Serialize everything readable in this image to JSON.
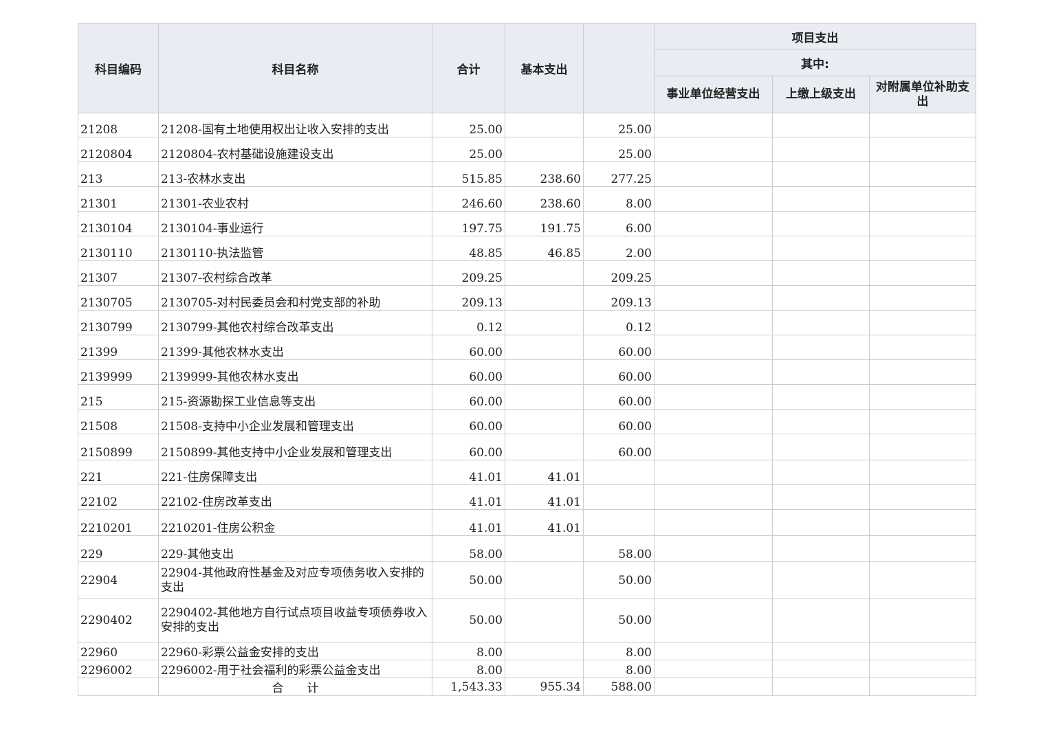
{
  "headers": {
    "code": "科目编码",
    "name": "科目名称",
    "total": "合计",
    "basic": "基本支出",
    "project": "",
    "project_group": "项目支出",
    "of_which": "其中:",
    "business": "事业单位经营支出",
    "upper": "上缴上级支出",
    "subsidy": "对附属单位补助支出"
  },
  "rows": [
    {
      "code": "21208",
      "name": "21208-国有土地使用权出让收入安排的支出",
      "total": "25.00",
      "basic": "",
      "project": "25.00"
    },
    {
      "code": "2120804",
      "name": "2120804-农村基础设施建设支出",
      "total": "25.00",
      "basic": "",
      "project": "25.00"
    },
    {
      "code": "213",
      "name": "213-农林水支出",
      "total": "515.85",
      "basic": "238.60",
      "project": "277.25"
    },
    {
      "code": "21301",
      "name": "21301-农业农村",
      "total": "246.60",
      "basic": "238.60",
      "project": "8.00"
    },
    {
      "code": "2130104",
      "name": "2130104-事业运行",
      "total": "197.75",
      "basic": "191.75",
      "project": "6.00"
    },
    {
      "code": "2130110",
      "name": "2130110-执法监管",
      "total": "48.85",
      "basic": "46.85",
      "project": "2.00"
    },
    {
      "code": "21307",
      "name": "21307-农村综合改革",
      "total": "209.25",
      "basic": "",
      "project": "209.25"
    },
    {
      "code": "2130705",
      "name": "2130705-对村民委员会和村党支部的补助",
      "total": "209.13",
      "basic": "",
      "project": "209.13"
    },
    {
      "code": "2130799",
      "name": "2130799-其他农村综合改革支出",
      "total": "0.12",
      "basic": "",
      "project": "0.12"
    },
    {
      "code": "21399",
      "name": "21399-其他农林水支出",
      "total": "60.00",
      "basic": "",
      "project": "60.00"
    },
    {
      "code": "2139999",
      "name": "2139999-其他农林水支出",
      "total": "60.00",
      "basic": "",
      "project": "60.00"
    },
    {
      "code": "215",
      "name": "215-资源勘探工业信息等支出",
      "total": "60.00",
      "basic": "",
      "project": "60.00"
    },
    {
      "code": "21508",
      "name": "21508-支持中小企业发展和管理支出",
      "total": "60.00",
      "basic": "",
      "project": "60.00"
    },
    {
      "code": "2150899",
      "name": "2150899-其他支持中小企业发展和管理支出",
      "total": "60.00",
      "basic": "",
      "project": "60.00"
    },
    {
      "code": "221",
      "name": "221-住房保障支出",
      "total": "41.01",
      "basic": "41.01",
      "project": ""
    },
    {
      "code": "22102",
      "name": "22102-住房改革支出",
      "total": "41.01",
      "basic": "41.01",
      "project": ""
    },
    {
      "code": "2210201",
      "name": "2210201-住房公积金",
      "total": "41.01",
      "basic": "41.01",
      "project": ""
    },
    {
      "code": "229",
      "name": "229-其他支出",
      "total": "58.00",
      "basic": "",
      "project": "58.00"
    },
    {
      "code": "22904",
      "name": "22904-其他政府性基金及对应专项债务收入安排的支出",
      "total": "50.00",
      "basic": "",
      "project": "50.00"
    },
    {
      "code": "2290402",
      "name": "2290402-其他地方自行试点项目收益专项债券收入安排的支出",
      "total": "50.00",
      "basic": "",
      "project": "50.00"
    },
    {
      "code": "22960",
      "name": "22960-彩票公益金安排的支出",
      "total": "8.00",
      "basic": "",
      "project": "8.00"
    },
    {
      "code": "2296002",
      "name": "2296002-用于社会福利的彩票公益金支出",
      "total": "8.00",
      "basic": "",
      "project": "8.00"
    }
  ],
  "total_row": {
    "label": "合　　计",
    "total": "1,543.33",
    "basic": "955.34",
    "project": "588.00"
  }
}
